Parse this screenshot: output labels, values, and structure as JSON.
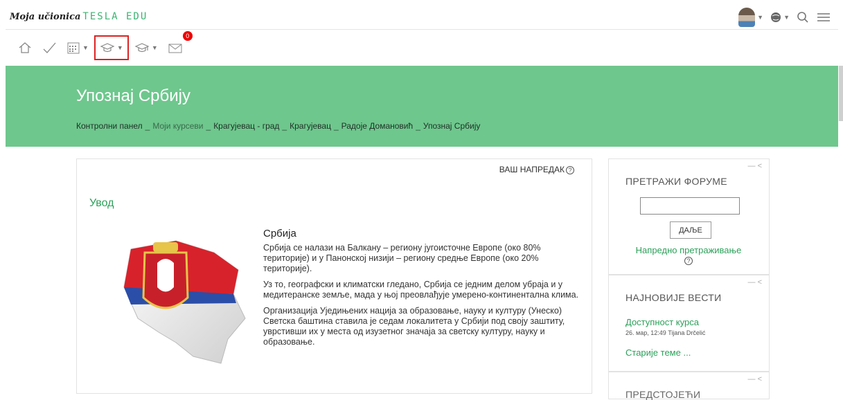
{
  "header": {
    "brand_script": "Moja učionica",
    "brand_logo": "TESLA EDU"
  },
  "navbar": {
    "icons": [
      "home-icon",
      "check-icon",
      "calendar-icon",
      "graduation-cap-icon",
      "teacher-cap-icon",
      "mail-icon"
    ],
    "message_count": "0"
  },
  "hero": {
    "title": "Упознај Србију",
    "breadcrumb": [
      "Контролни панел",
      "Моји курсеви",
      "Крагујевац - град",
      "Крагујевац",
      "Радоје Домановић",
      "Упознај Србију"
    ]
  },
  "main": {
    "progress_label": "ВАШ НАПРЕДАК",
    "section_title": "Увод",
    "heading": "Србија",
    "p1": "Србија се налази на Балкану – региону југоисточне Европе (око 80% територије) и у Панонској низији – региону средње Европе (око 20% територије).",
    "p2": "Уз то, географски и климатски гледано, Србија се једним делом убраја и у медитеранске земље, мада у њој преовлађује умерено-континентална клима.",
    "p3": "Организација Уједињених нација за образовање, науку и културу (Унеско) Светска баштина ставила је седам локалитета у Србији под своју заштиту, уврстивши их у места од изузетног значаја за светску културу, науку и образовање."
  },
  "sidebar": {
    "search_title": "ПРЕТРАЖИ ФОРУМЕ",
    "search_button": "ДАЉЕ",
    "advanced_search": "Напредно претраживање",
    "news_title": "НАЈНОВИЈЕ ВЕСТИ",
    "news_item": "Доступност курса",
    "news_meta": "26. мар, 12:49  Tijana Drčelić",
    "older_topics": "Старије теме ...",
    "third_title": "ПРЕДСТОЈЕЋИ"
  },
  "colors": {
    "accent": "#6ec78d",
    "link": "#2ca05a",
    "badge": "#e00000"
  }
}
